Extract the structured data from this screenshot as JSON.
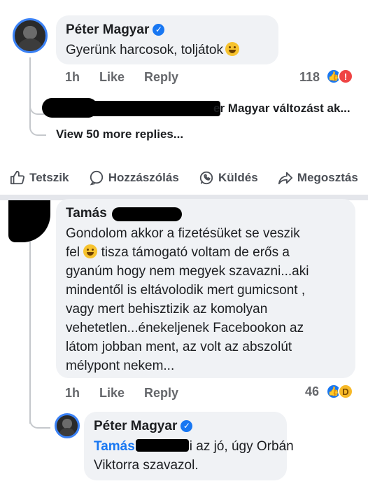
{
  "comment1": {
    "author": "Péter Magyar",
    "text": "Gyerünk harcosok, toljátok",
    "time": "1h",
    "like_label": "Like",
    "reply_label": "Reply",
    "reaction_count": "118"
  },
  "reply_preview": {
    "text": "er Magyar változást ak..."
  },
  "view_more": "View 50 more replies...",
  "actions": {
    "like": "Tetszik",
    "comment": "Hozzászólás",
    "send": "Küldés",
    "share": "Megosztás"
  },
  "comment2": {
    "author": "Tamás",
    "text_line1": "Gondolom akkor a fizetésüket se veszik",
    "text_line2a": "fel",
    "text_line2b": "tisza támogató voltam de erős a",
    "text_line3": "gyanúm hogy nem megyek szavazni...aki",
    "text_line4": "mindentől is eltávolodik mert gumicsont ,",
    "text_line5": "vagy mert behisztizik az komolyan",
    "text_line6": "vehetetlen...énekeljenek Facebookon az",
    "text_line7": "látom jobban ment, az volt az abszolút",
    "text_line8": "mélypont nekem...",
    "time": "1h",
    "like_label": "Like",
    "reply_label": "Reply",
    "reaction_count": "46"
  },
  "reply2": {
    "author": "Péter Magyar",
    "mention": "Tamás",
    "text_line1": "i az jó, úgy Orbán",
    "text_line2": "Viktorra szavazol."
  },
  "colors": {
    "accent": "#1877f2",
    "bubble": "#f0f2f5",
    "meta": "#65676b"
  }
}
